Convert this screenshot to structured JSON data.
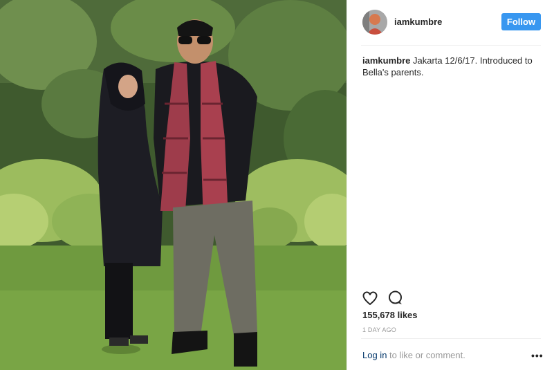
{
  "post": {
    "username": "iamkumbre",
    "follow_label": "Follow",
    "caption": {
      "username": "iamkumbre",
      "text": "Jakarta 12/6/17. Introduced to Bella's parents."
    },
    "likes": "155,678 likes",
    "timestamp": "1 DAY AGO",
    "comment": {
      "login_label": "Log in",
      "rest": "to like or comment."
    },
    "more_label": "•••",
    "icons": {
      "like": "heart-icon",
      "comment": "comment-bubble-icon",
      "more": "more-options-icon"
    },
    "colors": {
      "follow_button": "#3897f0",
      "login_link": "#003569",
      "muted_text": "#999999"
    }
  }
}
